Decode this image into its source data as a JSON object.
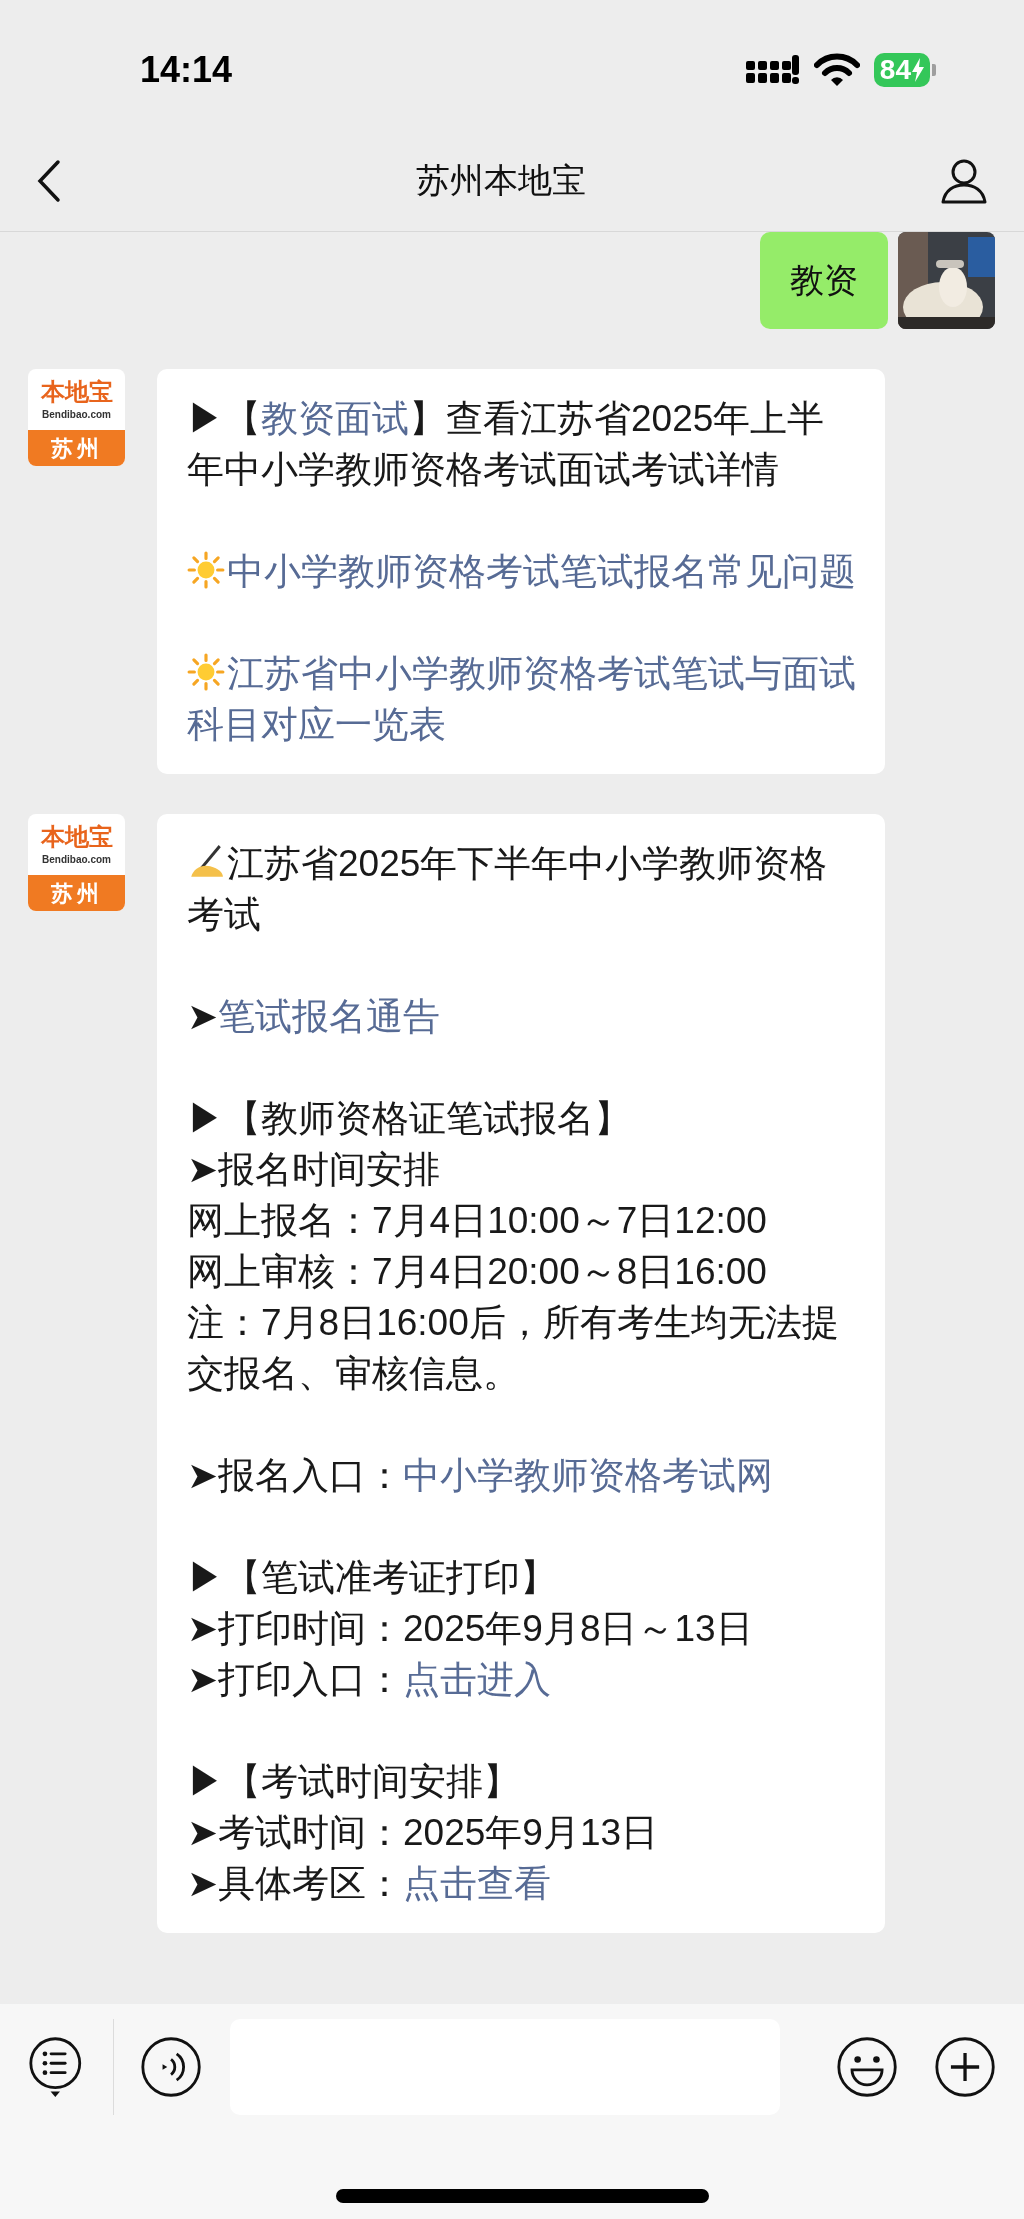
{
  "status_bar": {
    "time": "14:14",
    "battery": "84"
  },
  "header": {
    "title": "苏州本地宝"
  },
  "messages": [
    {
      "kind": "user",
      "text": "教资"
    },
    {
      "kind": "official",
      "logo": {
        "name": "本地宝",
        "domain": "Bendibao.com",
        "city": "苏州"
      },
      "paragraphs": [
        {
          "rows": [
            {
              "kind": "plain",
              "segments": [
                {
                  "kind": "text",
                  "text": "▶【"
                },
                {
                  "kind": "link",
                  "text": "教资面试"
                },
                {
                  "kind": "text",
                  "text": "】查看江苏省2025年上半年中小学教师资格考试面试考试详情"
                }
              ]
            }
          ]
        },
        {
          "rows": [
            {
              "kind": "sun",
              "segments": [
                {
                  "kind": "link",
                  "text": "中小学教师资格考试笔试报名常见问题"
                }
              ]
            }
          ]
        },
        {
          "rows": [
            {
              "kind": "sun",
              "segments": [
                {
                  "kind": "link",
                  "text": "江苏省中小学教师资格考试笔试与面试科目对应一览表"
                }
              ]
            }
          ]
        }
      ]
    },
    {
      "kind": "official",
      "logo": {
        "name": "本地宝",
        "domain": "Bendibao.com",
        "city": "苏州"
      },
      "paragraphs": [
        {
          "rows": [
            {
              "kind": "hand",
              "segments": [
                {
                  "kind": "text",
                  "text": "江苏省2025年下半年中小学教师资格考试"
                }
              ]
            }
          ]
        },
        {
          "rows": [
            {
              "kind": "plain",
              "segments": [
                {
                  "kind": "text",
                  "text": "➤"
                },
                {
                  "kind": "link",
                  "text": "笔试报名通告"
                }
              ]
            }
          ]
        },
        {
          "rows": [
            {
              "kind": "plain",
              "segments": [
                {
                  "kind": "text",
                  "text": "▶【教师资格证笔试报名】"
                }
              ]
            },
            {
              "kind": "plain",
              "segments": [
                {
                  "kind": "text",
                  "text": "➤报名时间安排"
                }
              ]
            },
            {
              "kind": "plain",
              "segments": [
                {
                  "kind": "text",
                  "text": "网上报名：7月4日10:00～7日12:00"
                }
              ]
            },
            {
              "kind": "plain",
              "segments": [
                {
                  "kind": "text",
                  "text": "网上审核：7月4日20:00～8日16:00"
                }
              ]
            },
            {
              "kind": "plain",
              "segments": [
                {
                  "kind": "text",
                  "text": "注：7月8日16:00后，所有考生均无法提交报名、审核信息。"
                }
              ]
            }
          ]
        },
        {
          "rows": [
            {
              "kind": "plain",
              "segments": [
                {
                  "kind": "text",
                  "text": "➤报名入口："
                },
                {
                  "kind": "link",
                  "text": "中小学教师资格考试网"
                }
              ]
            }
          ]
        },
        {
          "rows": [
            {
              "kind": "plain",
              "segments": [
                {
                  "kind": "text",
                  "text": "▶【笔试准考证打印】"
                }
              ]
            },
            {
              "kind": "plain",
              "segments": [
                {
                  "kind": "text",
                  "text": "➤打印时间：2025年9月8日～13日"
                }
              ]
            },
            {
              "kind": "plain",
              "segments": [
                {
                  "kind": "text",
                  "text": "➤打印入口："
                },
                {
                  "kind": "link",
                  "text": "点击进入"
                }
              ]
            }
          ]
        },
        {
          "rows": [
            {
              "kind": "plain",
              "segments": [
                {
                  "kind": "text",
                  "text": "▶【考试时间安排】"
                }
              ]
            },
            {
              "kind": "plain",
              "segments": [
                {
                  "kind": "text",
                  "text": "➤考试时间：2025年9月13日"
                }
              ]
            },
            {
              "kind": "plain",
              "segments": [
                {
                  "kind": "text",
                  "text": "➤具体考区："
                },
                {
                  "kind": "link",
                  "text": "点击查看"
                }
              ]
            }
          ]
        }
      ]
    }
  ]
}
